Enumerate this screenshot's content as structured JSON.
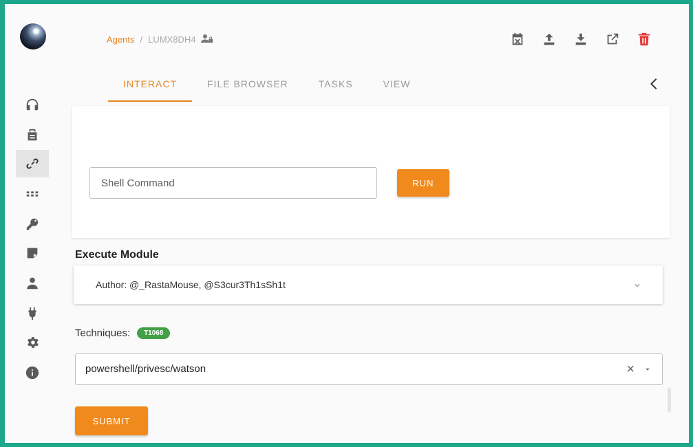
{
  "breadcrumb": {
    "root": "Agents",
    "separator": "/",
    "current": "LUMX8DH4",
    "user_icon": "user-lock-icon"
  },
  "header_actions": [
    {
      "name": "calendar-x-icon",
      "danger": false
    },
    {
      "name": "upload-icon",
      "danger": false
    },
    {
      "name": "download-icon",
      "danger": false
    },
    {
      "name": "open-external-icon",
      "danger": false
    },
    {
      "name": "trash-icon",
      "danger": true
    }
  ],
  "tabs": [
    {
      "label": "INTERACT",
      "active": true
    },
    {
      "label": "FILE BROWSER",
      "active": false
    },
    {
      "label": "TASKS",
      "active": false
    },
    {
      "label": "VIEW",
      "active": false
    }
  ],
  "sidebar": {
    "items": [
      {
        "icon": "headphones-icon",
        "active": false
      },
      {
        "icon": "briefcase-lock-icon",
        "active": false
      },
      {
        "icon": "link-icon",
        "active": true
      },
      {
        "icon": "apps-grid-icon",
        "active": false
      },
      {
        "icon": "key-icon",
        "active": false
      },
      {
        "icon": "sticky-note-icon",
        "active": false
      },
      {
        "icon": "user-icon",
        "active": false
      },
      {
        "icon": "plug-icon",
        "active": false
      },
      {
        "icon": "gear-icon",
        "active": false
      },
      {
        "icon": "info-icon",
        "active": false
      }
    ]
  },
  "shell": {
    "placeholder": "Shell Command",
    "run_label": "RUN"
  },
  "execute_module": {
    "title": "Execute Module",
    "author": "Author: @_RastaMouse, @S3cur3Th1sSh1t",
    "techniques_label": "Techniques:",
    "technique_chip": "T1068",
    "module_value": "powershell/privesc/watson",
    "clear_symbol": "×",
    "submit_label": "SUBMIT"
  },
  "colors": {
    "accent": "#f08a1c",
    "frame": "#1ea88b",
    "chip": "#43a047",
    "danger": "#e53935"
  }
}
